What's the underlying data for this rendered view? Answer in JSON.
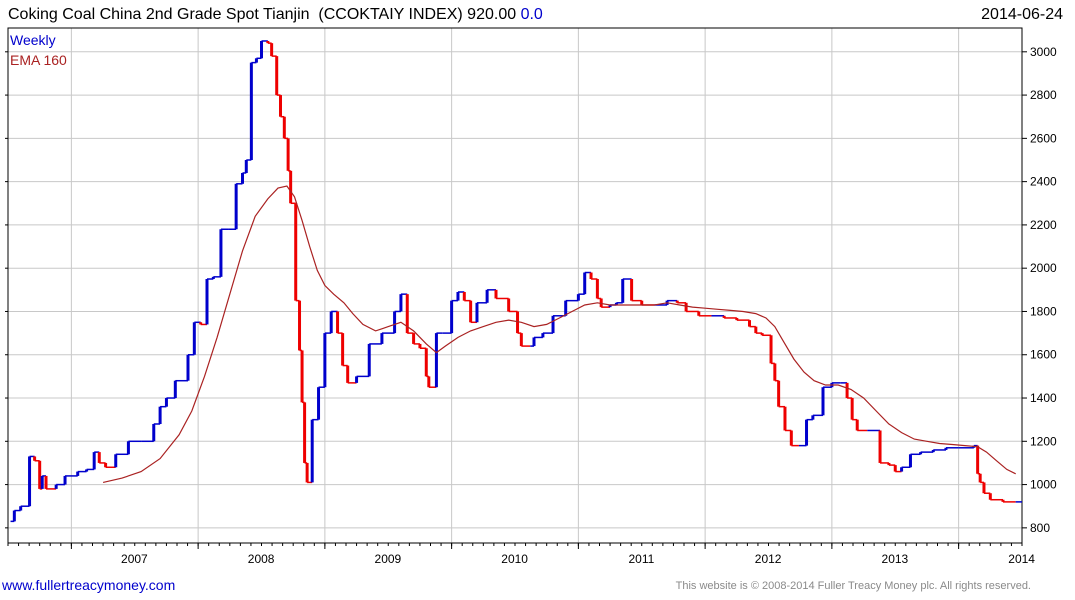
{
  "header": {
    "title": "Coking Coal China 2nd Grade Spot Tianjin",
    "symbol": "(CCOKTAIY INDEX)",
    "last": "920.00",
    "change": "0.0",
    "date": "2014-06-24"
  },
  "footer": {
    "site": "www.fullertreacymoney.com",
    "copyright": "This website is © 2008-2014 Fuller Treacy Money plc. All rights reserved."
  },
  "colors": {
    "up": "#0000cc",
    "down": "#ee0000",
    "ema": "#aa2222",
    "grid": "#c8c8c8",
    "axis": "#000000"
  },
  "chart_data": {
    "type": "line",
    "subtype": "weekly price bars with moving average",
    "legend": [
      "Weekly",
      "EMA 160"
    ],
    "legend_placement": "top-left",
    "x_ticks": [
      "2007",
      "2008",
      "2009",
      "2010",
      "2011",
      "2012",
      "2013",
      "2014"
    ],
    "y_ticks": [
      800,
      1000,
      1200,
      1400,
      1600,
      1800,
      2000,
      2200,
      2400,
      2600,
      2800,
      3000
    ],
    "ylim": [
      730,
      3110
    ],
    "xlim": [
      2006.5,
      2014.5
    ],
    "y_axis_side": "right",
    "grid": true,
    "series": [
      {
        "name": "Weekly",
        "points": [
          [
            2006.52,
            830
          ],
          [
            2006.55,
            880
          ],
          [
            2006.6,
            900
          ],
          [
            2006.67,
            1130
          ],
          [
            2006.71,
            1110
          ],
          [
            2006.75,
            980
          ],
          [
            2006.77,
            1040
          ],
          [
            2006.8,
            980
          ],
          [
            2006.88,
            1000
          ],
          [
            2006.95,
            1040
          ],
          [
            2007.05,
            1060
          ],
          [
            2007.12,
            1070
          ],
          [
            2007.18,
            1150
          ],
          [
            2007.22,
            1100
          ],
          [
            2007.27,
            1080
          ],
          [
            2007.35,
            1140
          ],
          [
            2007.45,
            1200
          ],
          [
            2007.55,
            1200
          ],
          [
            2007.65,
            1280
          ],
          [
            2007.7,
            1360
          ],
          [
            2007.75,
            1400
          ],
          [
            2007.82,
            1480
          ],
          [
            2007.92,
            1600
          ],
          [
            2007.97,
            1750
          ],
          [
            2008.02,
            1740
          ],
          [
            2008.07,
            1950
          ],
          [
            2008.12,
            1960
          ],
          [
            2008.18,
            2180
          ],
          [
            2008.24,
            2180
          ],
          [
            2008.3,
            2390
          ],
          [
            2008.35,
            2440
          ],
          [
            2008.38,
            2500
          ],
          [
            2008.42,
            2950
          ],
          [
            2008.46,
            2970
          ],
          [
            2008.5,
            3050
          ],
          [
            2008.55,
            3040
          ],
          [
            2008.58,
            2980
          ],
          [
            2008.62,
            2800
          ],
          [
            2008.65,
            2700
          ],
          [
            2008.68,
            2600
          ],
          [
            2008.71,
            2450
          ],
          [
            2008.73,
            2300
          ],
          [
            2008.77,
            1850
          ],
          [
            2008.8,
            1620
          ],
          [
            2008.82,
            1380
          ],
          [
            2008.84,
            1100
          ],
          [
            2008.86,
            1010
          ],
          [
            2008.9,
            1300
          ],
          [
            2008.95,
            1450
          ],
          [
            2009.0,
            1700
          ],
          [
            2009.05,
            1800
          ],
          [
            2009.1,
            1700
          ],
          [
            2009.14,
            1550
          ],
          [
            2009.18,
            1470
          ],
          [
            2009.25,
            1500
          ],
          [
            2009.35,
            1650
          ],
          [
            2009.45,
            1700
          ],
          [
            2009.55,
            1800
          ],
          [
            2009.6,
            1880
          ],
          [
            2009.65,
            1700
          ],
          [
            2009.7,
            1650
          ],
          [
            2009.75,
            1630
          ],
          [
            2009.8,
            1500
          ],
          [
            2009.82,
            1450
          ],
          [
            2009.88,
            1700
          ],
          [
            2009.93,
            1700
          ],
          [
            2010.0,
            1850
          ],
          [
            2010.05,
            1890
          ],
          [
            2010.1,
            1850
          ],
          [
            2010.15,
            1750
          ],
          [
            2010.2,
            1840
          ],
          [
            2010.28,
            1900
          ],
          [
            2010.35,
            1860
          ],
          [
            2010.45,
            1800
          ],
          [
            2010.52,
            1700
          ],
          [
            2010.55,
            1640
          ],
          [
            2010.62,
            1640
          ],
          [
            2010.65,
            1680
          ],
          [
            2010.72,
            1700
          ],
          [
            2010.8,
            1780
          ],
          [
            2010.9,
            1850
          ],
          [
            2011.0,
            1880
          ],
          [
            2011.05,
            1980
          ],
          [
            2011.1,
            1950
          ],
          [
            2011.15,
            1860
          ],
          [
            2011.18,
            1820
          ],
          [
            2011.25,
            1830
          ],
          [
            2011.3,
            1840
          ],
          [
            2011.35,
            1950
          ],
          [
            2011.42,
            1850
          ],
          [
            2011.5,
            1830
          ],
          [
            2011.6,
            1830
          ],
          [
            2011.7,
            1850
          ],
          [
            2011.78,
            1840
          ],
          [
            2011.85,
            1800
          ],
          [
            2011.95,
            1780
          ],
          [
            2012.05,
            1780
          ],
          [
            2012.15,
            1770
          ],
          [
            2012.25,
            1760
          ],
          [
            2012.35,
            1730
          ],
          [
            2012.4,
            1700
          ],
          [
            2012.45,
            1690
          ],
          [
            2012.52,
            1560
          ],
          [
            2012.55,
            1480
          ],
          [
            2012.58,
            1360
          ],
          [
            2012.63,
            1250
          ],
          [
            2012.68,
            1180
          ],
          [
            2012.74,
            1180
          ],
          [
            2012.8,
            1300
          ],
          [
            2012.85,
            1320
          ],
          [
            2012.93,
            1450
          ],
          [
            2013.0,
            1470
          ],
          [
            2013.07,
            1470
          ],
          [
            2013.12,
            1400
          ],
          [
            2013.16,
            1300
          ],
          [
            2013.2,
            1250
          ],
          [
            2013.28,
            1250
          ],
          [
            2013.38,
            1100
          ],
          [
            2013.45,
            1090
          ],
          [
            2013.5,
            1060
          ],
          [
            2013.55,
            1080
          ],
          [
            2013.62,
            1140
          ],
          [
            2013.7,
            1150
          ],
          [
            2013.8,
            1160
          ],
          [
            2013.9,
            1170
          ],
          [
            2014.0,
            1170
          ],
          [
            2014.12,
            1180
          ],
          [
            2014.15,
            1050
          ],
          [
            2014.17,
            1010
          ],
          [
            2014.2,
            960
          ],
          [
            2014.25,
            930
          ],
          [
            2014.35,
            920
          ],
          [
            2014.45,
            920
          ]
        ]
      },
      {
        "name": "EMA 160",
        "points": [
          [
            2007.25,
            1010
          ],
          [
            2007.4,
            1030
          ],
          [
            2007.55,
            1060
          ],
          [
            2007.7,
            1120
          ],
          [
            2007.85,
            1230
          ],
          [
            2007.95,
            1340
          ],
          [
            2008.05,
            1500
          ],
          [
            2008.15,
            1680
          ],
          [
            2008.25,
            1880
          ],
          [
            2008.35,
            2080
          ],
          [
            2008.45,
            2240
          ],
          [
            2008.55,
            2320
          ],
          [
            2008.63,
            2370
          ],
          [
            2008.7,
            2380
          ],
          [
            2008.76,
            2330
          ],
          [
            2008.82,
            2220
          ],
          [
            2008.88,
            2100
          ],
          [
            2008.94,
            1990
          ],
          [
            2009.0,
            1920
          ],
          [
            2009.07,
            1880
          ],
          [
            2009.15,
            1840
          ],
          [
            2009.22,
            1790
          ],
          [
            2009.3,
            1740
          ],
          [
            2009.4,
            1710
          ],
          [
            2009.5,
            1730
          ],
          [
            2009.6,
            1750
          ],
          [
            2009.7,
            1710
          ],
          [
            2009.8,
            1650
          ],
          [
            2009.88,
            1610
          ],
          [
            2009.95,
            1640
          ],
          [
            2010.05,
            1680
          ],
          [
            2010.15,
            1710
          ],
          [
            2010.25,
            1730
          ],
          [
            2010.35,
            1750
          ],
          [
            2010.45,
            1760
          ],
          [
            2010.55,
            1750
          ],
          [
            2010.65,
            1730
          ],
          [
            2010.75,
            1740
          ],
          [
            2010.85,
            1770
          ],
          [
            2010.95,
            1800
          ],
          [
            2011.05,
            1830
          ],
          [
            2011.15,
            1840
          ],
          [
            2011.25,
            1830
          ],
          [
            2011.35,
            1830
          ],
          [
            2011.5,
            1830
          ],
          [
            2011.6,
            1830
          ],
          [
            2011.7,
            1840
          ],
          [
            2011.8,
            1830
          ],
          [
            2011.9,
            1820
          ],
          [
            2012.0,
            1815
          ],
          [
            2012.1,
            1810
          ],
          [
            2012.2,
            1805
          ],
          [
            2012.3,
            1800
          ],
          [
            2012.4,
            1790
          ],
          [
            2012.48,
            1770
          ],
          [
            2012.55,
            1730
          ],
          [
            2012.62,
            1660
          ],
          [
            2012.7,
            1580
          ],
          [
            2012.78,
            1520
          ],
          [
            2012.86,
            1480
          ],
          [
            2012.95,
            1460
          ],
          [
            2013.05,
            1460
          ],
          [
            2013.15,
            1440
          ],
          [
            2013.25,
            1400
          ],
          [
            2013.35,
            1340
          ],
          [
            2013.45,
            1280
          ],
          [
            2013.55,
            1240
          ],
          [
            2013.65,
            1210
          ],
          [
            2013.75,
            1200
          ],
          [
            2013.85,
            1190
          ],
          [
            2013.95,
            1185
          ],
          [
            2014.05,
            1180
          ],
          [
            2014.15,
            1175
          ],
          [
            2014.22,
            1150
          ],
          [
            2014.3,
            1110
          ],
          [
            2014.38,
            1070
          ],
          [
            2014.45,
            1050
          ]
        ]
      }
    ]
  }
}
